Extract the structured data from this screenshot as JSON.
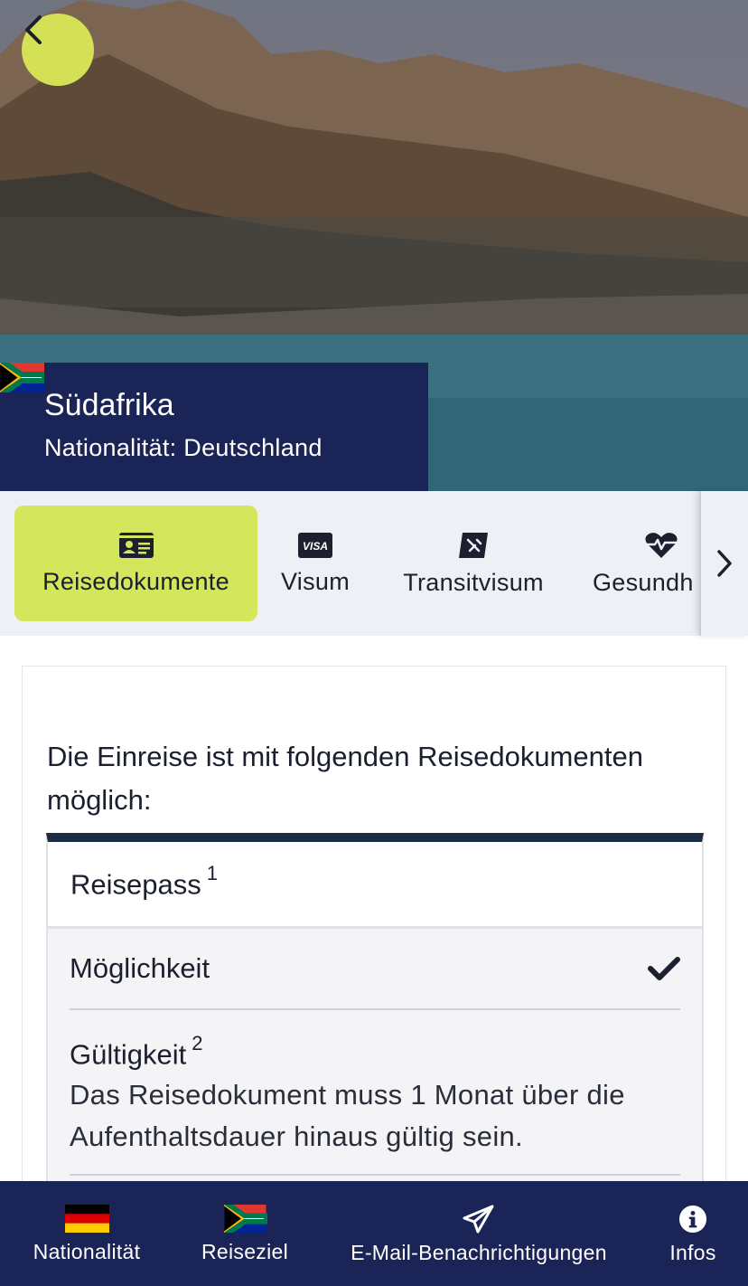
{
  "header": {
    "destination": "Südafrika",
    "nationality_line": "Nationalität: Deutschland"
  },
  "tabs": [
    {
      "label": "Reisedokumente",
      "icon": "id-card-icon",
      "active": true
    },
    {
      "label": "Visum",
      "icon": "visa-icon",
      "active": false
    },
    {
      "label": "Transitvisum",
      "icon": "transit-icon",
      "active": false
    },
    {
      "label": "Gesundh",
      "icon": "heart-pulse-icon",
      "active": false
    }
  ],
  "visa_badge": "VISA",
  "content": {
    "intro": "Die Einreise ist mit folgenden Reisedokumenten möglich:",
    "document": {
      "title": "Reisepass",
      "title_sup": "1",
      "possibility_label": "Möglichkeit",
      "possibility_value": "check",
      "validity_label": "Gültigkeit",
      "validity_sup": "2",
      "validity_text": "Das Reisedokument muss 1 Monat über die Aufenthaltsdauer hinaus gültig sein."
    }
  },
  "bottom_nav": [
    {
      "label": "Nationalität",
      "icon": "flag-germany-icon"
    },
    {
      "label": "Reiseziel",
      "icon": "flag-south-africa-icon"
    },
    {
      "label": "E-Mail-Benachrichtigungen",
      "icon": "paper-plane-icon"
    },
    {
      "label": "Infos",
      "icon": "info-icon"
    }
  ],
  "colors": {
    "accent": "#d4e157",
    "navy": "#1b2456",
    "table_header_border": "#1b2c44"
  }
}
